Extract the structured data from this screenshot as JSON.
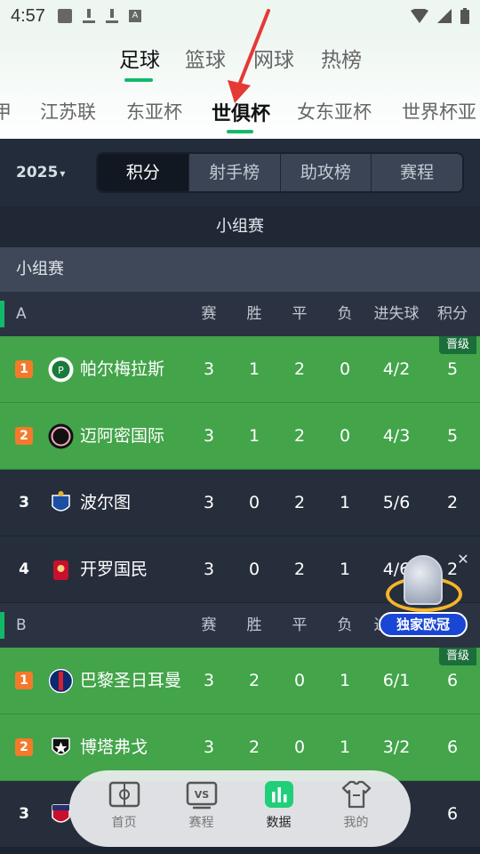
{
  "status_bar": {
    "time": "4:57"
  },
  "sport_tabs": [
    {
      "label": "足球",
      "active": true
    },
    {
      "label": "篮球",
      "active": false
    },
    {
      "label": "网球",
      "active": false
    },
    {
      "label": "热榜",
      "active": false
    }
  ],
  "competition_tabs": [
    {
      "label": "甲",
      "active": false
    },
    {
      "label": "江苏联",
      "active": false
    },
    {
      "label": "东亚杯",
      "active": false
    },
    {
      "label": "世俱杯",
      "active": true
    },
    {
      "label": "女东亚杯",
      "active": false
    },
    {
      "label": "世界杯亚",
      "active": false
    }
  ],
  "filters": {
    "season": "2025",
    "segments": [
      {
        "label": "积分",
        "active": true
      },
      {
        "label": "射手榜",
        "active": false
      },
      {
        "label": "助攻榜",
        "active": false
      },
      {
        "label": "赛程",
        "active": false
      }
    ]
  },
  "section_title": "小组赛",
  "subsection": "小组赛",
  "columns": [
    "赛",
    "胜",
    "平",
    "负",
    "进失球",
    "积分"
  ],
  "groups": [
    {
      "name": "A",
      "rows": [
        {
          "rank": "1",
          "team": "帕尔梅拉斯",
          "played": "3",
          "won": "1",
          "drawn": "2",
          "lost": "0",
          "goals": "4/2",
          "points": "5",
          "qualified": true,
          "badge": "晋级"
        },
        {
          "rank": "2",
          "team": "迈阿密国际",
          "played": "3",
          "won": "1",
          "drawn": "2",
          "lost": "0",
          "goals": "4/3",
          "points": "5",
          "qualified": true,
          "badge": ""
        },
        {
          "rank": "3",
          "team": "波尔图",
          "played": "3",
          "won": "0",
          "drawn": "2",
          "lost": "1",
          "goals": "5/6",
          "points": "2",
          "qualified": false,
          "badge": ""
        },
        {
          "rank": "4",
          "team": "开罗国民",
          "played": "3",
          "won": "0",
          "drawn": "2",
          "lost": "1",
          "goals": "4/6",
          "points": "2",
          "qualified": false,
          "badge": ""
        }
      ]
    },
    {
      "name": "B",
      "rows": [
        {
          "rank": "1",
          "team": "巴黎圣日耳曼",
          "played": "3",
          "won": "2",
          "drawn": "0",
          "lost": "1",
          "goals": "6/1",
          "points": "6",
          "qualified": true,
          "badge": "晋级"
        },
        {
          "rank": "2",
          "team": "博塔弗戈",
          "played": "3",
          "won": "2",
          "drawn": "0",
          "lost": "1",
          "goals": "3/2",
          "points": "6",
          "qualified": true,
          "badge": ""
        },
        {
          "rank": "3",
          "team": "",
          "played": "",
          "won": "",
          "drawn": "",
          "lost": "",
          "goals": "",
          "points": "6",
          "qualified": false,
          "badge": ""
        }
      ]
    }
  ],
  "promo": {
    "label": "独家欧冠"
  },
  "bottom_nav": [
    {
      "label": "首页",
      "icon": "pitch-icon",
      "active": false
    },
    {
      "label": "赛程",
      "icon": "vs-icon",
      "active": false
    },
    {
      "label": "数据",
      "icon": "chart-icon",
      "active": true
    },
    {
      "label": "我的",
      "icon": "jersey-icon",
      "active": false
    }
  ],
  "colors": {
    "accent": "#13b96a",
    "qualified_row": "#43a44a",
    "rank_badge": "#f37a2a"
  }
}
